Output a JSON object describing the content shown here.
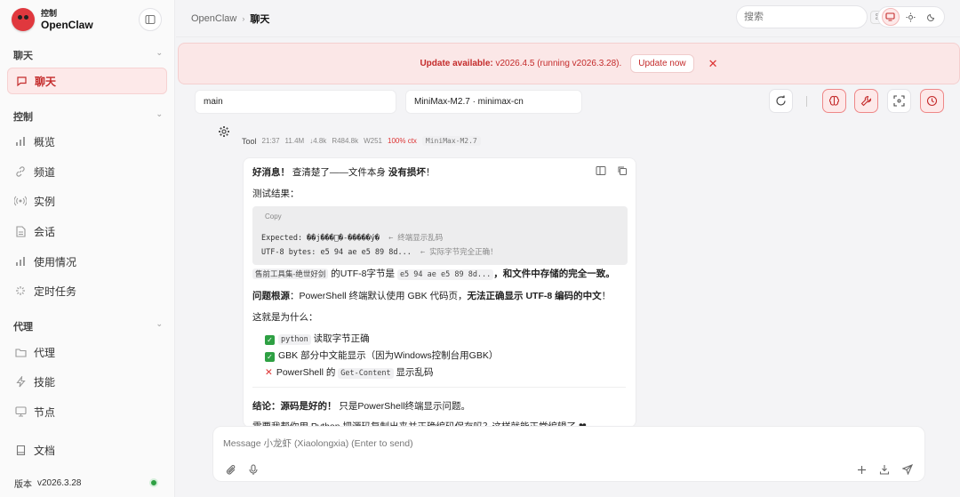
{
  "brand": {
    "sub": "控制",
    "name": "OpenClaw"
  },
  "sidebar": {
    "sections": [
      {
        "label": "聊天"
      },
      {
        "label": "控制"
      },
      {
        "label": "代理"
      }
    ],
    "items": [
      {
        "label": "聊天",
        "icon": "chat-icon",
        "active": true
      },
      {
        "label": "概览",
        "icon": "bar-chart-icon"
      },
      {
        "label": "频道",
        "icon": "link-icon"
      },
      {
        "label": "实例",
        "icon": "radio-icon"
      },
      {
        "label": "会话",
        "icon": "document-icon"
      },
      {
        "label": "使用情况",
        "icon": "bar-chart-icon"
      },
      {
        "label": "定时任务",
        "icon": "loader-icon"
      },
      {
        "label": "代理",
        "icon": "folder-icon"
      },
      {
        "label": "技能",
        "icon": "zap-icon"
      },
      {
        "label": "节点",
        "icon": "monitor-icon"
      },
      {
        "label": "文档",
        "icon": "book-icon"
      }
    ],
    "version_label": "版本",
    "version": "v2026.3.28",
    "status_color": "#2ea043"
  },
  "header": {
    "breadcrumb": [
      "OpenClaw",
      "聊天"
    ],
    "search_placeholder": "搜索",
    "search_kbd": "⌘K"
  },
  "banner": {
    "title": "Update available:",
    "detail": " v2026.4.5 (running v2026.3.28).",
    "button": "Update now"
  },
  "selectors": {
    "session": "main",
    "model": "MiniMax-M2.7 · minimax-cn"
  },
  "message": {
    "role": "Tool",
    "time": "21:37",
    "meta": [
      "11.4M",
      "↓4.8k",
      "R484.8k",
      "W251"
    ],
    "ctx": "100% ctx",
    "model": "MiniMax-M2.7",
    "line1_bold": "好消息！",
    "line1_text": " 查清楚了——文件本身 ",
    "line1_bold2": "没有损坏",
    "line1_end": "！",
    "line2": "测试结果：",
    "code": {
      "copy": "Copy",
      "l1": "Expected: ��j���\u0000�-�����ý�",
      "l1c": "← 终端显示乱码",
      "l2": "UTF-8 bytes: e5 94 ae e5 89 8d...",
      "l2c": "← 实际字节完全正确！"
    },
    "line3_code": "售前工具集-绝世好剑",
    "line3_mid": " 的UTF-8字节是 ",
    "line3_code2": "e5 94 ae e5 89 8d...",
    "line3_bold": "，和文件中存储的完全一致。",
    "line4_bold": "问题根源",
    "line4_text": "：PowerShell 终端默认使用 GBK 代码页，",
    "line4_bold2": "无法正确显示 UTF-8 编码的中文",
    "line4_end": "！",
    "line5": "这就是为什么：",
    "b1_code": "python",
    "b1_text": " 读取字节正确",
    "b2_text": "GBK 部分中文能显示（因为Windows控制台用GBK）",
    "b3_pre": "PowerShell 的 ",
    "b3_code": "Get-Content",
    "b3_text": " 显示乱码",
    "line6_bold": "结论：源码是好的！",
    "line6_text": " 只是PowerShell终端显示问题。",
    "line7": "需要我帮你用 Python 把源码复制出来并正确编码保存吗？这样就能正常编辑了 ❤"
  },
  "composer": {
    "placeholder": "Message 小龙虾 (Xiaolongxia) (Enter to send)"
  }
}
